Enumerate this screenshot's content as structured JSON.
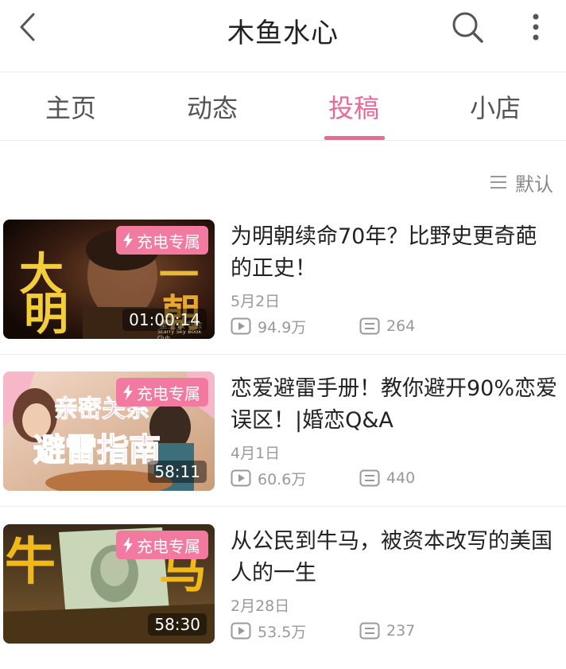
{
  "header": {
    "title": "木鱼水心",
    "back_icon": "chevron-left-icon",
    "search_icon": "search-icon",
    "more_icon": "more-vertical-icon"
  },
  "tabs": [
    {
      "label": "主页",
      "active": false
    },
    {
      "label": "动态",
      "active": false
    },
    {
      "label": "投稿",
      "active": true
    },
    {
      "label": "小店",
      "active": false
    }
  ],
  "colors": {
    "accent": "#ea6a97",
    "badge": "#f27aa0",
    "muted": "#999999"
  },
  "sort": {
    "label": "默认",
    "icon": "list-icon"
  },
  "videos": [
    {
      "title": "为明朝续命70年？比野史更奇葩的正史！",
      "date": "5月2日",
      "plays": "94.9万",
      "comments": "264",
      "duration": "01:00:14",
      "badge": "充电专属",
      "thumb_text": [
        "大",
        "明",
        "一",
        "朝"
      ],
      "thumb_subtext": "星空读书会",
      "thumb_subtext2": "Starry Sky Book Club"
    },
    {
      "title": "恋爱避雷手册！教你避开90%恋爱误区！|婚恋Q&A",
      "date": "4月1日",
      "plays": "60.6万",
      "comments": "440",
      "duration": "58:11",
      "badge": "充电专属",
      "thumb_text": [
        "亲密关系",
        "避雷指南"
      ]
    },
    {
      "title": "从公民到牛马，被资本改写的美国人的一生",
      "date": "2月28日",
      "plays": "53.5万",
      "comments": "237",
      "duration": "58:30",
      "badge": "充电专属",
      "thumb_text": [
        "牛",
        "马"
      ]
    }
  ]
}
